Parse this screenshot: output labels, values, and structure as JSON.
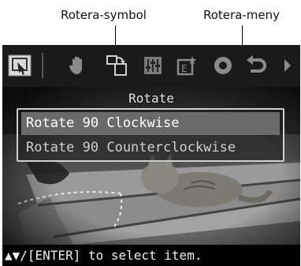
{
  "callouts": {
    "rotate_symbol": "Rotera-symbol",
    "rotate_menu": "Rotera-meny"
  },
  "toolbar": {
    "items": [
      {
        "icon": "select-arrow-icon",
        "selected": true
      },
      {
        "icon": "hand-pan-icon"
      },
      {
        "icon": "rotate-image-icon"
      },
      {
        "icon": "adjust-sliders-icon"
      },
      {
        "icon": "enhance-frame-icon"
      },
      {
        "icon": "red-eye-icon"
      },
      {
        "icon": "undo-icon"
      },
      {
        "icon": "scroll-right-icon"
      }
    ]
  },
  "menu": {
    "title": "Rotate",
    "items": [
      {
        "label": "Rotate 90 Clockwise",
        "selected": true
      },
      {
        "label": "Rotate 90 Counterclockwise",
        "selected": false
      }
    ]
  },
  "status": {
    "help_text": "▲▼/[ENTER] to select item."
  },
  "colors": {
    "screen_bg": "#111111",
    "highlight": "#6a6a6a",
    "panel_border": "#cfcfcf"
  }
}
